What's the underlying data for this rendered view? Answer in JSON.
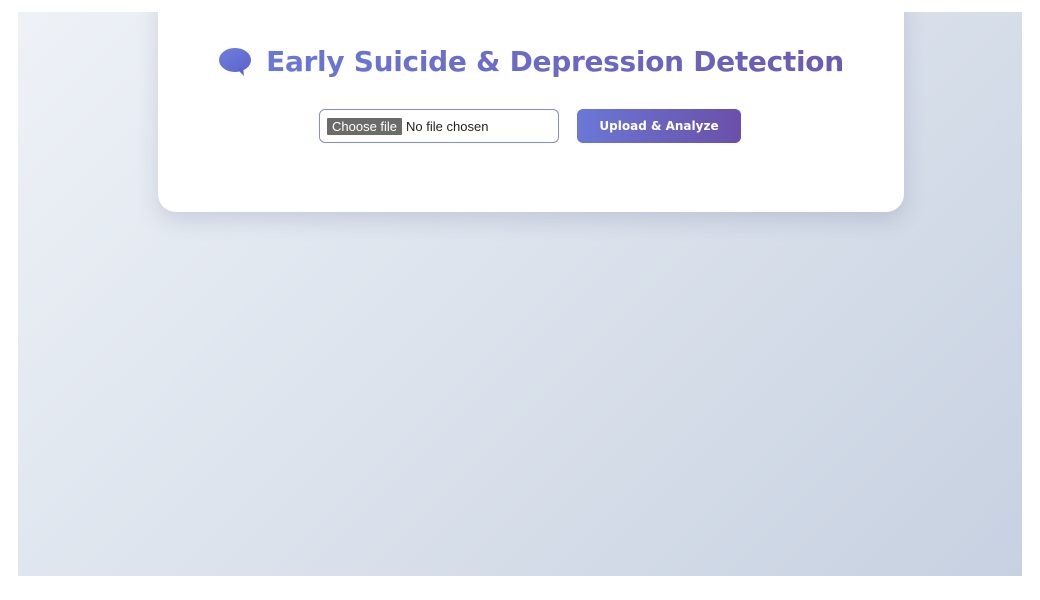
{
  "header": {
    "icon": "speech-bubble-icon",
    "title": "Early Suicide & Depression Detection"
  },
  "upload": {
    "choose_label": "Choose file",
    "file_status": "No file chosen",
    "submit_label": "Upload & Analyze"
  },
  "colors": {
    "accent_start": "#6a78d6",
    "accent_end": "#6b4fa8",
    "input_border": "#7d8fd8",
    "background_light": "#eef2f7",
    "background_dark": "#c7d1e1"
  }
}
